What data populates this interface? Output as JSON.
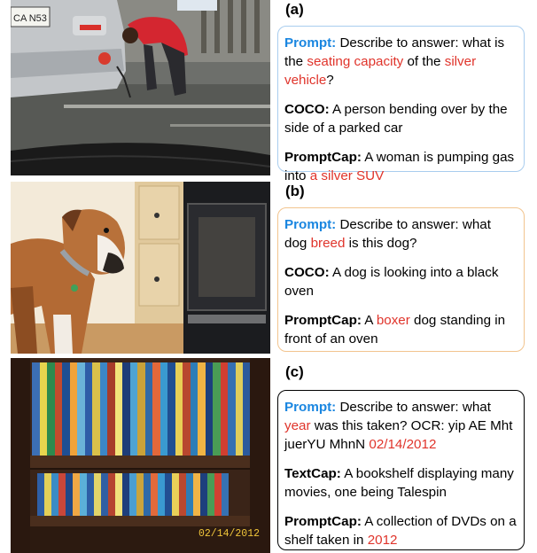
{
  "panels": [
    {
      "label": "(a)",
      "prompt_key": "Prompt:",
      "prompt_parts": [
        " Describe to answer: what is the ",
        "seating capacity",
        " of the ",
        "silver vehicle",
        "?"
      ],
      "coco_key": "COCO:",
      "coco_text": " A person bending over by the side of a parked car",
      "promptcap_key": "PromptCap:",
      "promptcap_parts": [
        " A woman is pumping gas into ",
        "a silver SUV"
      ],
      "plate_text": "CA N53",
      "border_color": "#a9cdee"
    },
    {
      "label": "(b)",
      "prompt_key": "Prompt:",
      "prompt_parts": [
        " Describe to answer: what dog ",
        "breed",
        " is this dog?"
      ],
      "coco_key": "COCO:",
      "coco_text": " A dog is looking into a black oven",
      "promptcap_key": "PromptCap:",
      "promptcap_parts": [
        " A ",
        "boxer",
        " dog standing in front of an oven"
      ],
      "border_color": "#f2c48e"
    },
    {
      "label": "(c)",
      "prompt_key": "Prompt:",
      "prompt_parts": [
        " Describe to answer: what ",
        "year",
        " was this taken? OCR: yip AE Mht juerYU MhnN ",
        "02/14/2012"
      ],
      "coco_key": "TextCap:",
      "coco_text": " A bookshelf displaying many movies, one being Talespin",
      "promptcap_key": "PromptCap:",
      "promptcap_parts": [
        " A collection of DVDs on a shelf taken in ",
        "2012"
      ],
      "timestamp": "02/14/2012",
      "border_color": "#000000"
    }
  ],
  "colors": {
    "prompt_key": "#1a86e0",
    "highlight": "#e0342b"
  }
}
